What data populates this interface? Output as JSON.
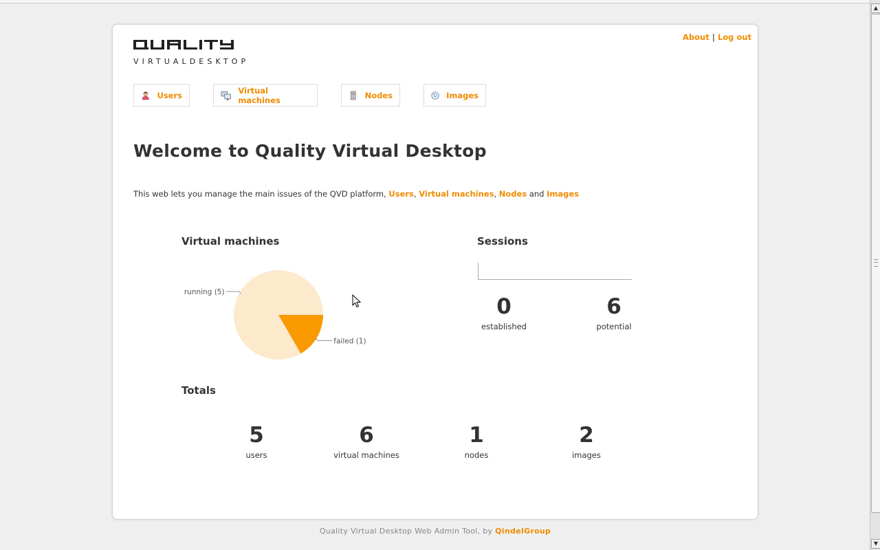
{
  "toplinks": {
    "about": "About",
    "separator": "|",
    "logout": "Log out"
  },
  "logo": {
    "word": "QUALITY",
    "sub": "VIRTUALDESKTOP"
  },
  "tabs": [
    {
      "label": "Users",
      "icon": "user-icon"
    },
    {
      "label": "Virtual machines",
      "icon": "monitors-icon"
    },
    {
      "label": "Nodes",
      "icon": "server-icon"
    },
    {
      "label": "Images",
      "icon": "disc-icon"
    }
  ],
  "welcome": {
    "title": "Welcome to Quality Virtual Desktop",
    "intro_prefix": "This web lets you manage the main issues of the QVD platform,",
    "links": [
      "Users",
      "Virtual machines",
      "Nodes",
      "Images"
    ],
    "comma": ",",
    "and": "and"
  },
  "vm_section": {
    "title": "Virtual machines"
  },
  "chart_data": {
    "type": "pie",
    "slices": [
      {
        "label": "running (5)",
        "value": 5,
        "color": "#fde9cc"
      },
      {
        "label": "failed (1)",
        "value": 1,
        "color": "#f99a00"
      }
    ]
  },
  "sessions": {
    "title": "Sessions",
    "established": {
      "value": "0",
      "label": "established"
    },
    "potential": {
      "value": "6",
      "label": "potential"
    }
  },
  "totals": {
    "title": "Totals",
    "items": [
      {
        "value": "5",
        "label": "users"
      },
      {
        "value": "6",
        "label": "virtual machines"
      },
      {
        "value": "1",
        "label": "nodes"
      },
      {
        "value": "2",
        "label": "images"
      }
    ]
  },
  "footer": {
    "text": "Quality Virtual Desktop Web Admin Tool, by",
    "link": "QindelGroup"
  },
  "colors": {
    "accent": "#f08c00",
    "pie_light": "#fde9cc",
    "pie_dark": "#f99a00"
  }
}
